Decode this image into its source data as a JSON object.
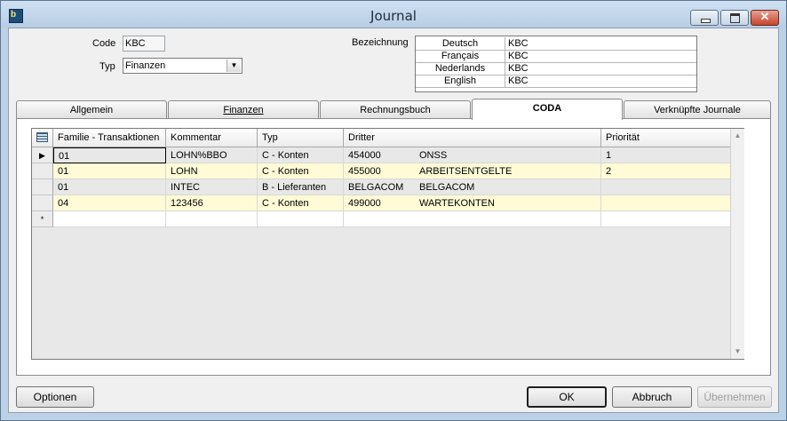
{
  "window": {
    "title": "Journal",
    "icon": "app-icon",
    "close_glyph": "✕"
  },
  "form": {
    "code_label": "Code",
    "code_value": "KBC",
    "type_label": "Typ",
    "type_value": "Finanzen",
    "bezeichnung_label": "Bezeichnung",
    "labels": [
      {
        "lang": "Deutsch",
        "value": "KBC"
      },
      {
        "lang": "Français",
        "value": "KBC"
      },
      {
        "lang": "Nederlands",
        "value": "KBC"
      },
      {
        "lang": "English",
        "value": "KBC"
      }
    ]
  },
  "tabs": [
    {
      "label": "Allgemein",
      "active": false
    },
    {
      "label": "Finanzen",
      "active": false
    },
    {
      "label": "Rechnungsbuch",
      "active": false
    },
    {
      "label": "CODA",
      "active": true
    },
    {
      "label": "Verknüpfte Journale",
      "active": false
    }
  ],
  "grid": {
    "columns": [
      "Familie - Transaktionen",
      "Kommentar",
      "Typ",
      "Dritter",
      "",
      "Priorität"
    ],
    "rows": [
      {
        "marker": "▶",
        "cells": [
          "01",
          "LOHN%BBO",
          "C - Konten",
          "454000",
          "ONSS",
          "1"
        ]
      },
      {
        "marker": "",
        "cells": [
          "01",
          "LOHN",
          "C - Konten",
          "455000",
          "ARBEITSENTGELTE",
          "2"
        ]
      },
      {
        "marker": "",
        "cells": [
          "01",
          "INTEC",
          "B - Lieferanten",
          "BELGACOM",
          "BELGACOM",
          ""
        ]
      },
      {
        "marker": "",
        "cells": [
          "04",
          "123456",
          "C - Konten",
          "499000",
          "WARTEKONTEN",
          ""
        ]
      },
      {
        "marker": "*",
        "cells": [
          "",
          "",
          "",
          "",
          "",
          ""
        ]
      }
    ],
    "scroll_up": "▲",
    "scroll_down": "▼"
  },
  "buttons": {
    "options": "Optionen",
    "ok": "OK",
    "cancel": "Abbruch",
    "apply": "Übernehmen"
  },
  "dropdown_arrow": "▼"
}
